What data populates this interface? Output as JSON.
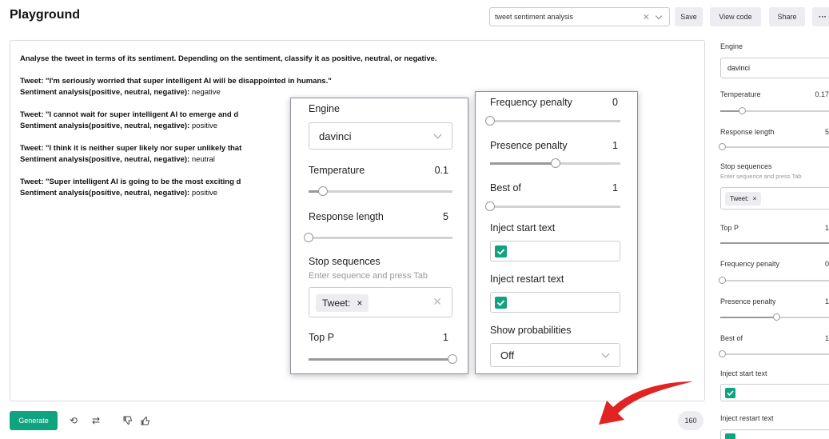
{
  "header": {
    "title": "Playground",
    "preset_value": "tweet sentiment analysis",
    "buttons": {
      "save": "Save",
      "view_code": "View code",
      "share": "Share",
      "more": "···"
    }
  },
  "prompt": {
    "lines": [
      {
        "bold": "Analyse the tweet in terms of its sentiment. Depending on the sentiment, classify it as positive, neutral, or negative.",
        "light": ""
      },
      {
        "bold": "",
        "light": ""
      },
      {
        "bold": "Tweet: \"I'm seriously worried that super intelligent AI will be disappointed in humans.\"",
        "light": ""
      },
      {
        "bold": "Sentiment analysis(positive, neutral, negative):",
        "light": " negative"
      },
      {
        "bold": "",
        "light": ""
      },
      {
        "bold": "Tweet: \"I cannot wait for super intelligent AI to emerge and d",
        "light": ""
      },
      {
        "bold": "Sentiment analysis(positive, neutral, negative):",
        "light": " positive"
      },
      {
        "bold": "",
        "light": ""
      },
      {
        "bold": "Tweet: \"I think it is neither super likely nor super unlikely that",
        "light": ""
      },
      {
        "bold": "Sentiment analysis(positive, neutral, negative):",
        "light": " neutral"
      },
      {
        "bold": "",
        "light": ""
      },
      {
        "bold": "Tweet: \"Super intelligent AI is going to be the most exciting d",
        "light": ""
      },
      {
        "bold": "Sentiment analysis(positive, neutral, negative):",
        "light": " positive"
      }
    ]
  },
  "toolbar": {
    "generate": "Generate",
    "token_count": "160"
  },
  "icons": {
    "undo": "undo-icon",
    "regenerate": "regenerate-icon",
    "thumbs_down": "thumbs-down-icon",
    "thumbs_up": "thumbs-up-icon"
  },
  "settings": {
    "engine_label": "Engine",
    "engine_value": "davinci",
    "temperature_label": "Temperature",
    "temperature_value": "0.1",
    "temperature_fraction": 0.1,
    "response_length_label": "Response length",
    "response_length_value": "5",
    "response_length_fraction": 0.0,
    "stop_sequences_label": "Stop sequences",
    "stop_sequences_hint": "Enter sequence and press Tab",
    "stop_chip": "Tweet:",
    "top_p_label": "Top P",
    "top_p_value": "1",
    "top_p_fraction": 1.0,
    "frequency_penalty_label": "Frequency penalty",
    "frequency_penalty_value": "0",
    "frequency_penalty_fraction": 0.0,
    "presence_penalty_label": "Presence penalty",
    "presence_penalty_value": "1",
    "presence_penalty_fraction": 0.5,
    "best_of_label": "Best of",
    "best_of_value": "1",
    "best_of_fraction": 0.0,
    "inject_start_label": "Inject start text",
    "inject_restart_label": "Inject restart text",
    "show_probabilities_label": "Show probabilities",
    "show_probabilities_value": "Off"
  },
  "sidebar": {
    "temperature_value": "0.17",
    "response_length_value": "5",
    "top_p_value": "1",
    "frequency_penalty_value": "0",
    "presence_penalty_value": "1",
    "best_of_value": "1"
  },
  "colors": {
    "accent": "#10a37f",
    "arrow": "#e02424"
  }
}
